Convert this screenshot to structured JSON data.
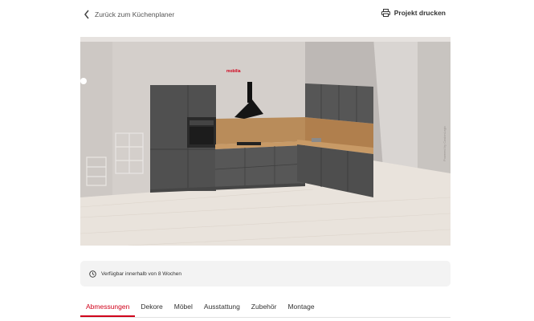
{
  "header": {
    "back_label": "Zurück zum Küchenplaner",
    "print_label": "Projekt drucken",
    "back_icon": "chevron-left-icon",
    "print_icon": "printer-icon"
  },
  "viewer": {
    "brand": "mobilia",
    "watermark": "Powered by CasionLogic"
  },
  "availability": {
    "icon": "clock-icon",
    "text": "Verfügbar innerhalb von 8 Wochen"
  },
  "tabs": [
    {
      "label": "Abmessungen",
      "active": true
    },
    {
      "label": "Dekore",
      "active": false
    },
    {
      "label": "Möbel",
      "active": false
    },
    {
      "label": "Ausstattung",
      "active": false
    },
    {
      "label": "Zubehör",
      "active": false
    },
    {
      "label": "Montage",
      "active": false
    }
  ],
  "colors": {
    "accent": "#d0021b",
    "cabinet": "#555555",
    "worktop": "#b98c5a",
    "floor": "#e9e3dc"
  }
}
